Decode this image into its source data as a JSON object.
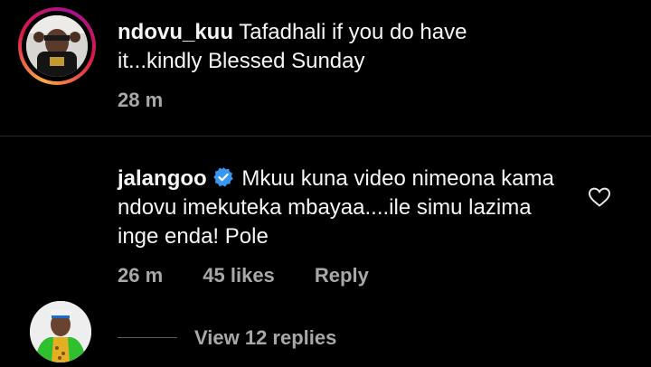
{
  "comments": [
    {
      "username": "ndovu_kuu",
      "text": "Tafadhali if you do have it...kindly Blessed Sunday",
      "time": "28 m"
    },
    {
      "username": "jalangoo",
      "verified": true,
      "text": "Mkuu kuna video nimeona kama ndovu imekuteka mbayaa....ile simu lazima inge enda! Pole",
      "time": "26 m",
      "likes": "45 likes",
      "reply_label": "Reply",
      "view_replies": "View 12 replies"
    }
  ],
  "colors": {
    "background": "#000000",
    "text": "#f5f5f5",
    "meta": "#a8a8a8",
    "verified": "#3897f0"
  }
}
